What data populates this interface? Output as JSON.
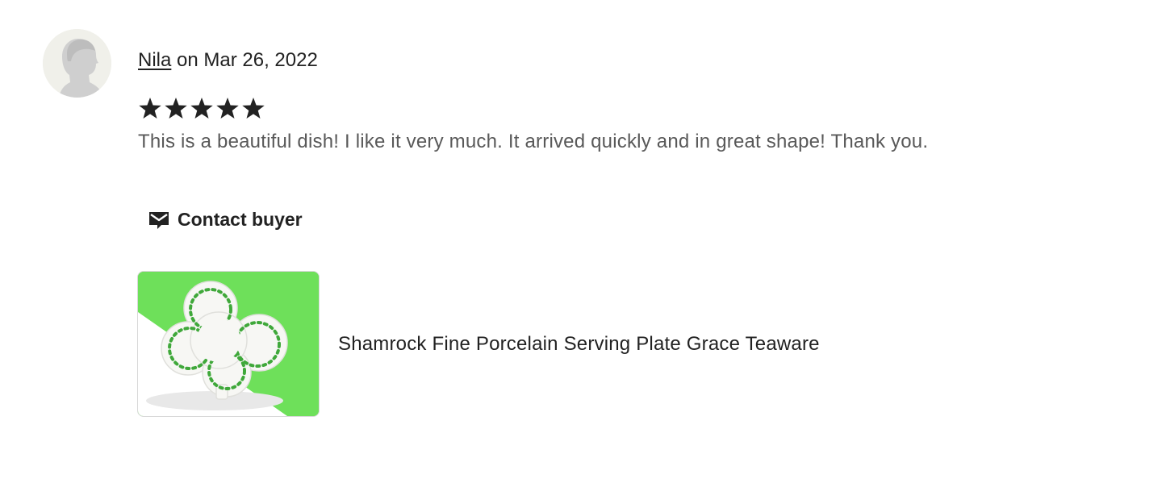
{
  "review": {
    "reviewer_name": "Nila",
    "date_text": "on Mar 26, 2022",
    "rating": 5,
    "rating_max": 5,
    "text": "This is a beautiful dish! I like it very much. It arrived quickly and in great shape! Thank you."
  },
  "actions": {
    "contact_label": "Contact buyer",
    "contact_icon": "mail-icon"
  },
  "listing": {
    "title": "Shamrock Fine Porcelain Serving Plate Grace Teaware",
    "image_icon": "shamrock-plate-image"
  },
  "colors": {
    "text": "#222222",
    "muted_text": "#595959",
    "avatar_bg": "#f0f0ea",
    "thumbnail_green": "#6ee05a"
  }
}
